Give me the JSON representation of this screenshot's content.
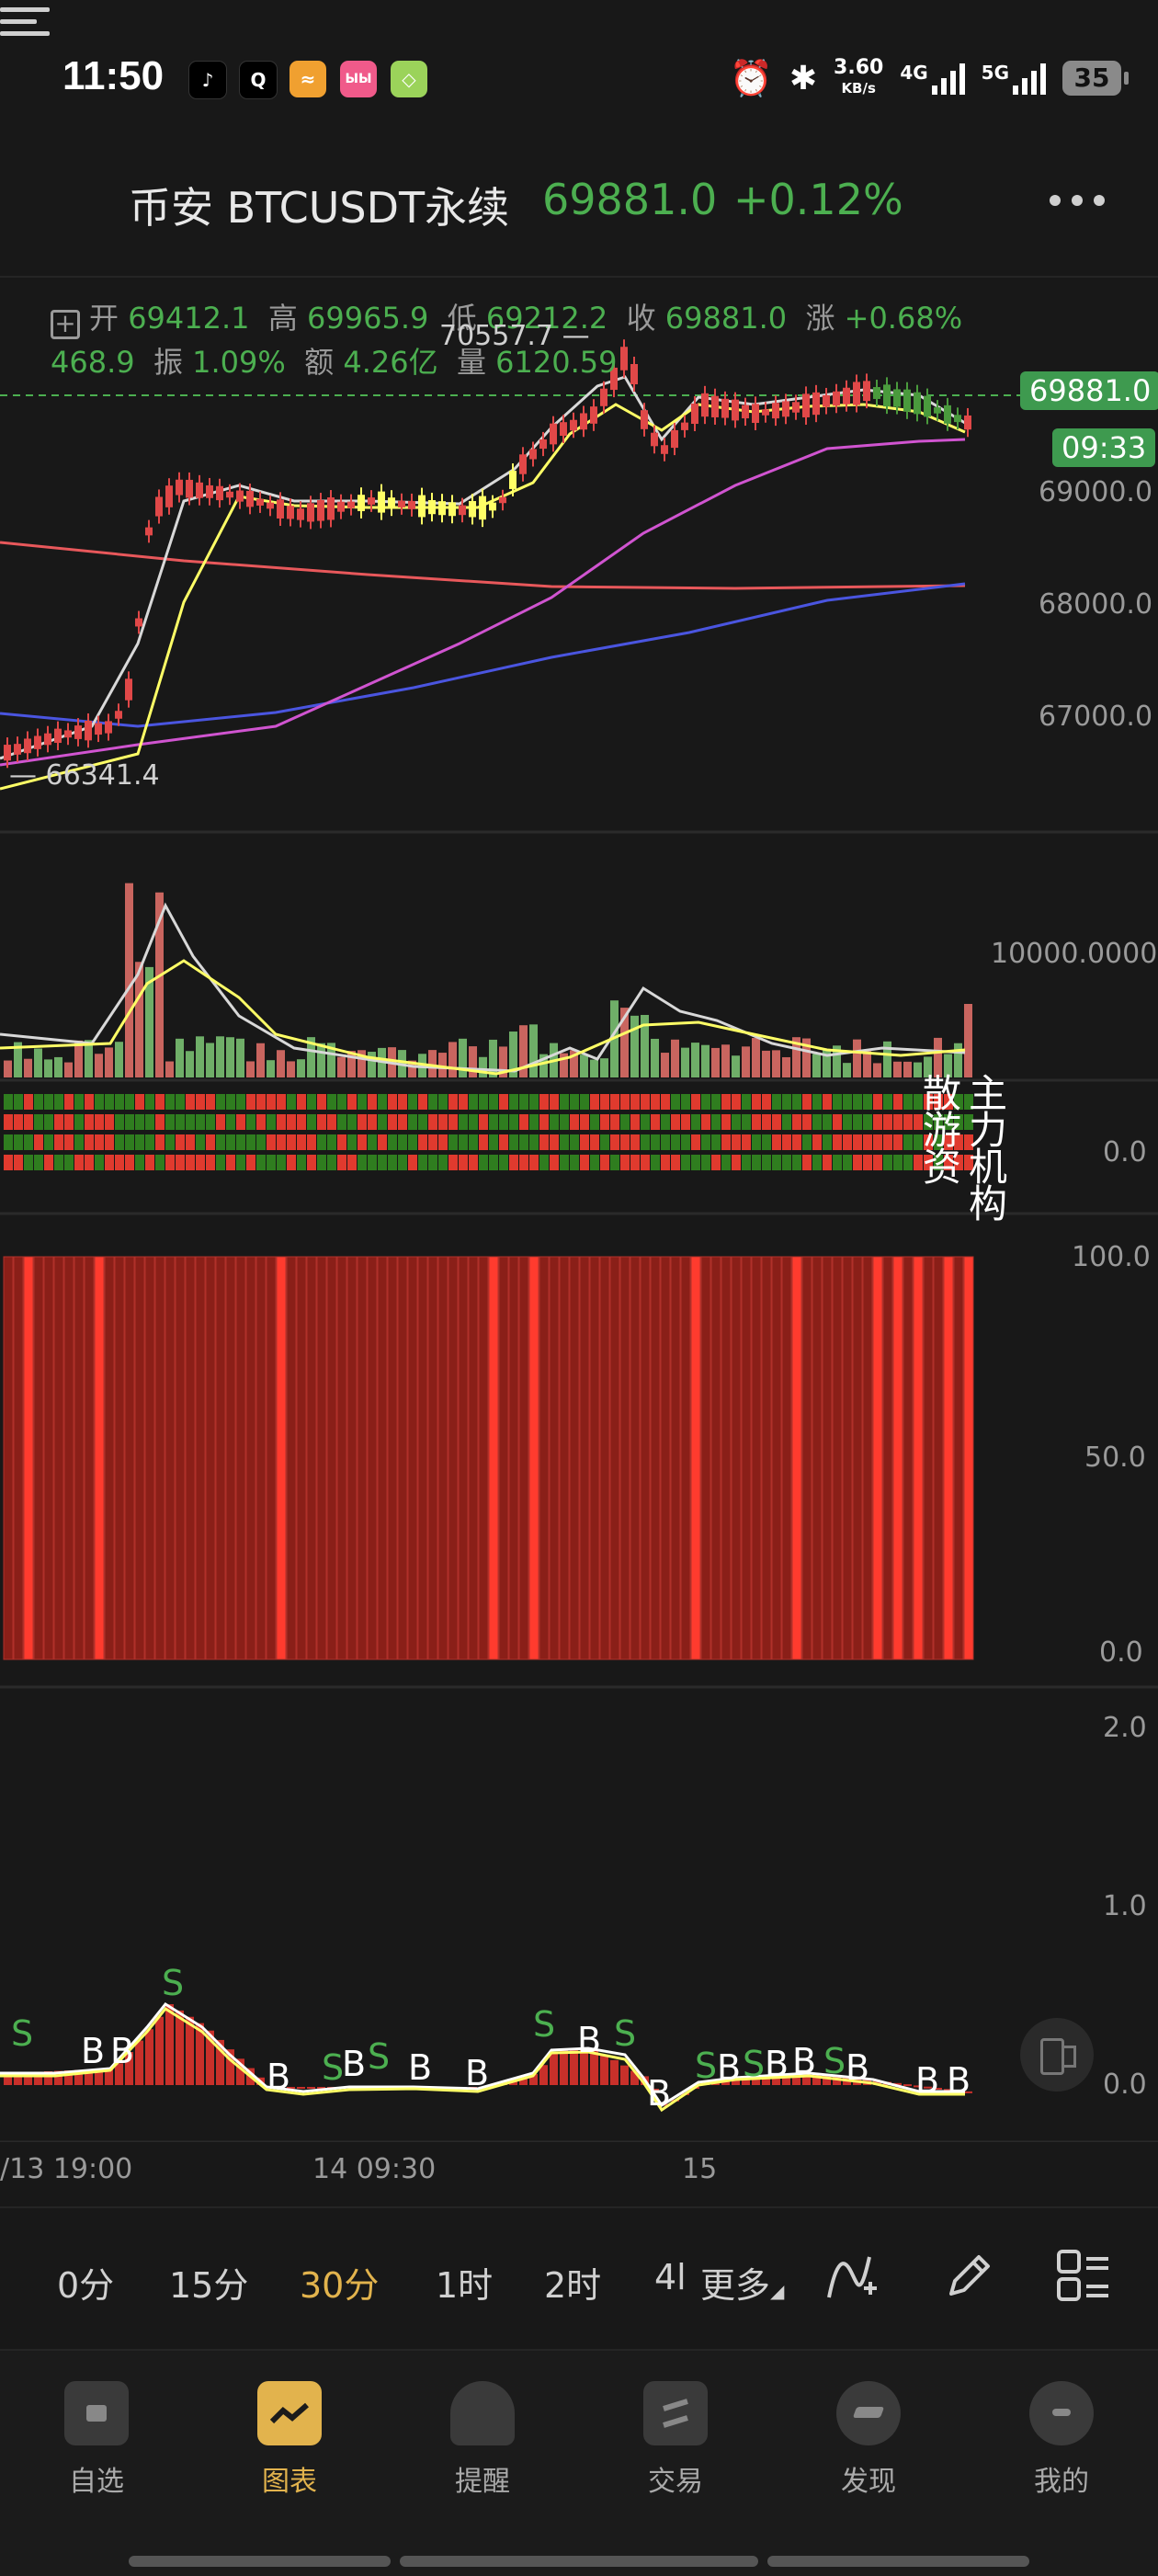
{
  "status": {
    "time": "11:50",
    "speed_top": "3.60",
    "speed_bottom": "KB/s",
    "net1": "4G",
    "net2": "5G",
    "battery": "35"
  },
  "header": {
    "title": "币安 BTCUSDT永续",
    "price": "69881.0",
    "change": "+0.12%"
  },
  "ohlc": {
    "open_label": "开",
    "open": "69412.1",
    "high_label": "高",
    "high": "69965.9",
    "low_label": "低",
    "low": "69212.2",
    "close_label": "收",
    "close": "69881.0",
    "rise_label": "涨",
    "rise": "+0.68%",
    "amt": "468.9",
    "amp_label": "振",
    "amp": "1.09%",
    "turnover_label": "额",
    "turnover": "4.26亿",
    "vol_label": "量",
    "vol": "6120.59"
  },
  "price_axis": [
    "69000.0",
    "68000.0",
    "67000.0"
  ],
  "last_price_tag": "69881.0",
  "countdown_tag": "09:33",
  "high_marker": "70557.7",
  "low_marker": "66341.4",
  "volume_axis": "10000.0000",
  "flow_axis": "0.0",
  "flow_labels": {
    "retail": "散户游资",
    "institution": "主力机构",
    "col1": "散",
    "col2": "游",
    "col3": "资",
    "col4": "主",
    "col5": "力",
    "col6": "机",
    "col7": "构"
  },
  "osc_axis": [
    "100.0",
    "50.0",
    "0.0"
  ],
  "bs_axis": [
    "2.0",
    "1.0",
    "0.0"
  ],
  "time_axis": [
    "/13 19:00",
    "14 09:30",
    "15"
  ],
  "timeframes": [
    "0分",
    "15分",
    "30分",
    "1时",
    "2时",
    "4l"
  ],
  "active_timeframe": "30分",
  "more_label": "更多",
  "nav": [
    "自选",
    "图表",
    "提醒",
    "交易",
    "发现",
    "我的"
  ],
  "active_nav": "图表",
  "colors": {
    "up": "#4caf50",
    "down": "#e53935",
    "accent": "#e2b34d"
  },
  "chart_data": {
    "type": "candlestick",
    "title": "",
    "price_ticks": [
      69000,
      68000,
      67000
    ],
    "last_price": 69881.0,
    "high_marker": 70557.7,
    "low_marker": 66341.4,
    "volume_ticks": [
      10000
    ],
    "osc_ticks": [
      0,
      50,
      100
    ],
    "bs_ticks": [
      0,
      1,
      2
    ],
    "x_ticks": [
      "/13 19:00",
      "14 09:30",
      "15"
    ]
  }
}
